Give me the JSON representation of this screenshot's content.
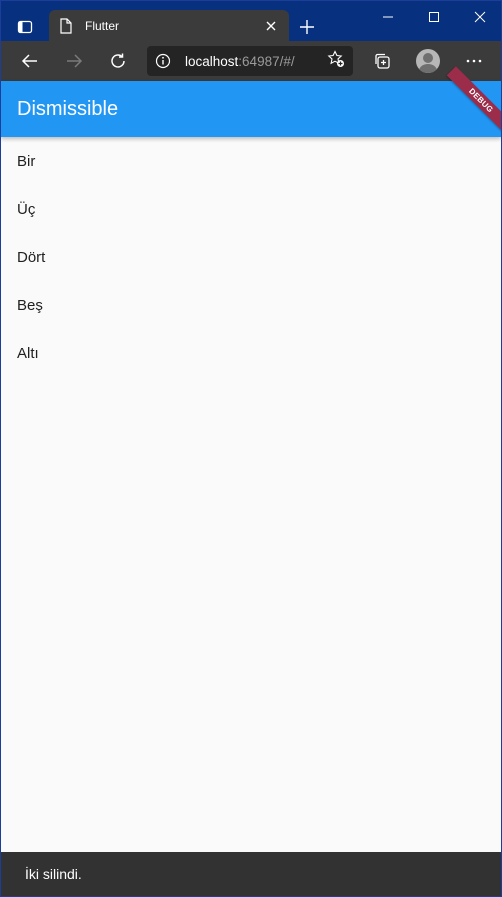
{
  "browser": {
    "tab": {
      "title": "Flutter"
    },
    "address": {
      "host": "localhost",
      "rest": ":64987/#/"
    }
  },
  "app": {
    "title": "Dismissible",
    "debug_banner": "DEBUG",
    "items": [
      {
        "label": "Bir"
      },
      {
        "label": "Üç"
      },
      {
        "label": "Dört"
      },
      {
        "label": "Beş"
      },
      {
        "label": "Altı"
      }
    ],
    "snackbar": {
      "message": "İki silindi."
    }
  },
  "colors": {
    "titlebar": "#07307f",
    "toolbar": "#3b3b3b",
    "appbar": "#2196f3",
    "debug_banner": "#9b2c4a",
    "snackbar": "#323232",
    "background": "#fafafa"
  }
}
